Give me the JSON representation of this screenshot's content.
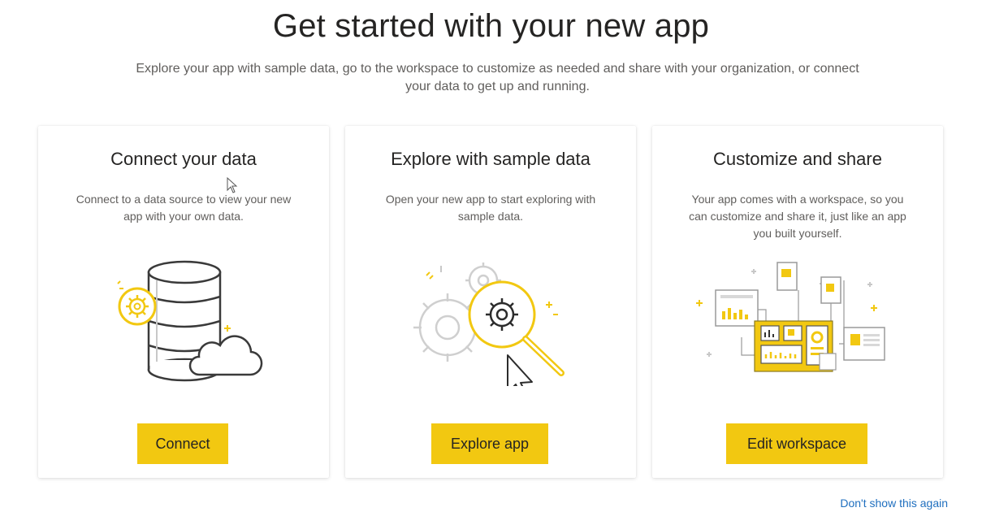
{
  "header": {
    "title": "Get started with your new app",
    "subtitle": "Explore your app with sample data, go to the workspace to customize as needed and share with your organization, or connect your data to get up and running."
  },
  "cards": [
    {
      "title": "Connect your data",
      "description": "Connect to a data source to view your new app with your own data.",
      "button_label": "Connect",
      "illustration": "database-cloud-icon"
    },
    {
      "title": "Explore with sample data",
      "description": "Open your new app to start exploring with sample data.",
      "button_label": "Explore app",
      "illustration": "gear-magnifier-icon"
    },
    {
      "title": "Customize and share",
      "description": "Your app comes with a workspace, so you can customize and share it, just like an app you built yourself.",
      "button_label": "Edit workspace",
      "illustration": "workspace-dashboard-icon"
    }
  ],
  "footer": {
    "dont_show_label": "Don't show this again"
  },
  "colors": {
    "accent": "#f2c811",
    "link": "#1f6fbf",
    "text": "#252423",
    "muted": "#605e5c"
  }
}
